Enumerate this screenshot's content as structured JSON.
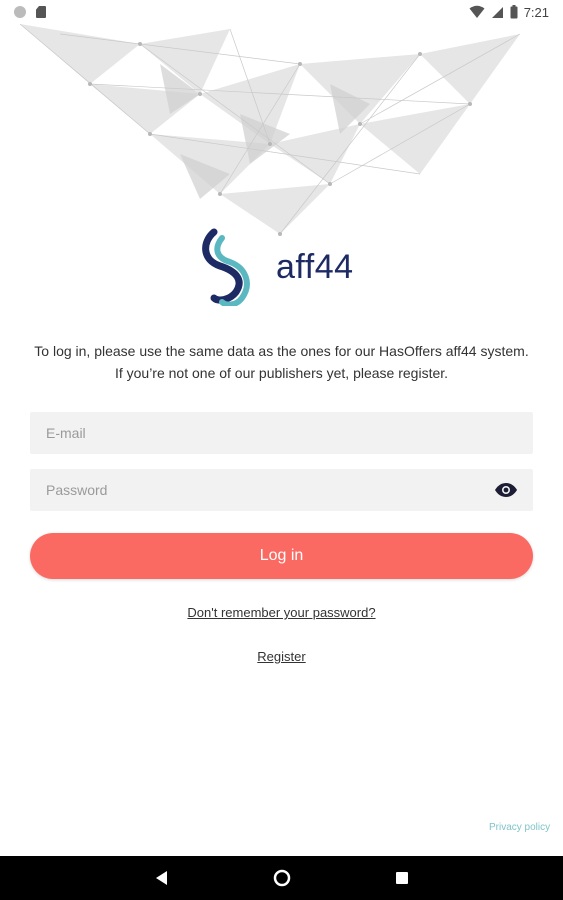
{
  "status_bar": {
    "time": "7:21",
    "icons": [
      "notification-dot-icon",
      "sd-card-icon",
      "wifi-icon",
      "signal-icon",
      "battery-icon"
    ]
  },
  "logo": {
    "text": "aff44",
    "colors": {
      "dark": "#1d2a63",
      "teal": "#5bb8c1"
    }
  },
  "intro": {
    "line1": "To log in, please use the same data as the ones for our HasOffers aff44 system.",
    "line2": "If you’re not one of our publishers yet, please register."
  },
  "form": {
    "email_placeholder": "E-mail",
    "email_value": "",
    "password_placeholder": "Password",
    "password_value": "",
    "login_label": "Log in",
    "forgot_label": "Don't remember your password?",
    "register_label": "Register"
  },
  "footer": {
    "privacy_label": "Privacy policy"
  },
  "colors": {
    "accent": "#fb6a62",
    "field_bg": "#f2f2f2",
    "link_teal": "#7fc4c9"
  },
  "nav_bar": {
    "buttons": [
      "back-icon",
      "home-icon",
      "recents-icon"
    ]
  }
}
